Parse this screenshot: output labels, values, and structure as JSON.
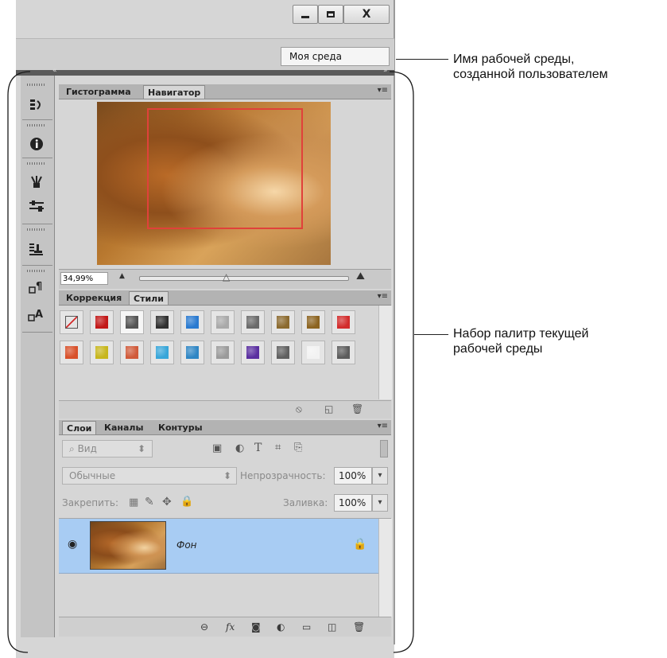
{
  "window": {
    "controls": [
      {
        "name": "minimize",
        "glyph": "▁"
      },
      {
        "name": "maximize",
        "glyph": "▢"
      },
      {
        "name": "close",
        "glyph": "X"
      }
    ],
    "workspace": "Моя среда",
    "collapse_left": "«",
    "collapse_right": "»"
  },
  "navigator_panel": {
    "tabs": [
      "Гистограмма",
      "Навигатор"
    ],
    "active_tab": "Навигатор",
    "zoom": "34,99%"
  },
  "styles_panel": {
    "tabs": [
      "Коррекция",
      "Стили"
    ],
    "active_tab": "Стили",
    "row1": [
      "#d32b2b",
      "#c21818",
      "#555555",
      "#303030",
      "#2a7ad0",
      "#a9a9a9",
      "#6a6a6a",
      "#8b6a2f",
      "#8c6421",
      "#d22c2c"
    ],
    "row2": [
      "#d8502a",
      "#c7b61d",
      "#d05a3a",
      "#38a6d9",
      "#2f86c4",
      "#9b9b9b",
      "#5a2fa0",
      "#606060",
      "#f2f2f2",
      "#5c5c5c"
    ]
  },
  "layers_panel": {
    "tabs": [
      "Слои",
      "Каналы",
      "Контуры"
    ],
    "active_tab": "Слои",
    "filter_placeholder": "Вид",
    "blend_mode": "Обычные",
    "opacity_label": "Непрозрачность:",
    "opacity_value": "100%",
    "lock_label": "Закрепить:",
    "fill_label": "Заливка:",
    "fill_value": "100%",
    "layers": [
      {
        "name": "Фон",
        "visible": true,
        "locked": true
      }
    ],
    "bottom_icons": [
      "link-icon",
      "fx-icon",
      "mask-icon",
      "adjustment-icon",
      "folder-icon",
      "new-layer-icon",
      "trash-icon"
    ]
  },
  "callouts": [
    {
      "line1": "Имя рабочей среды,",
      "line2": "созданной пользователем"
    },
    {
      "line1": "Набор палитр текущей",
      "line2": "рабочей среды"
    }
  ]
}
